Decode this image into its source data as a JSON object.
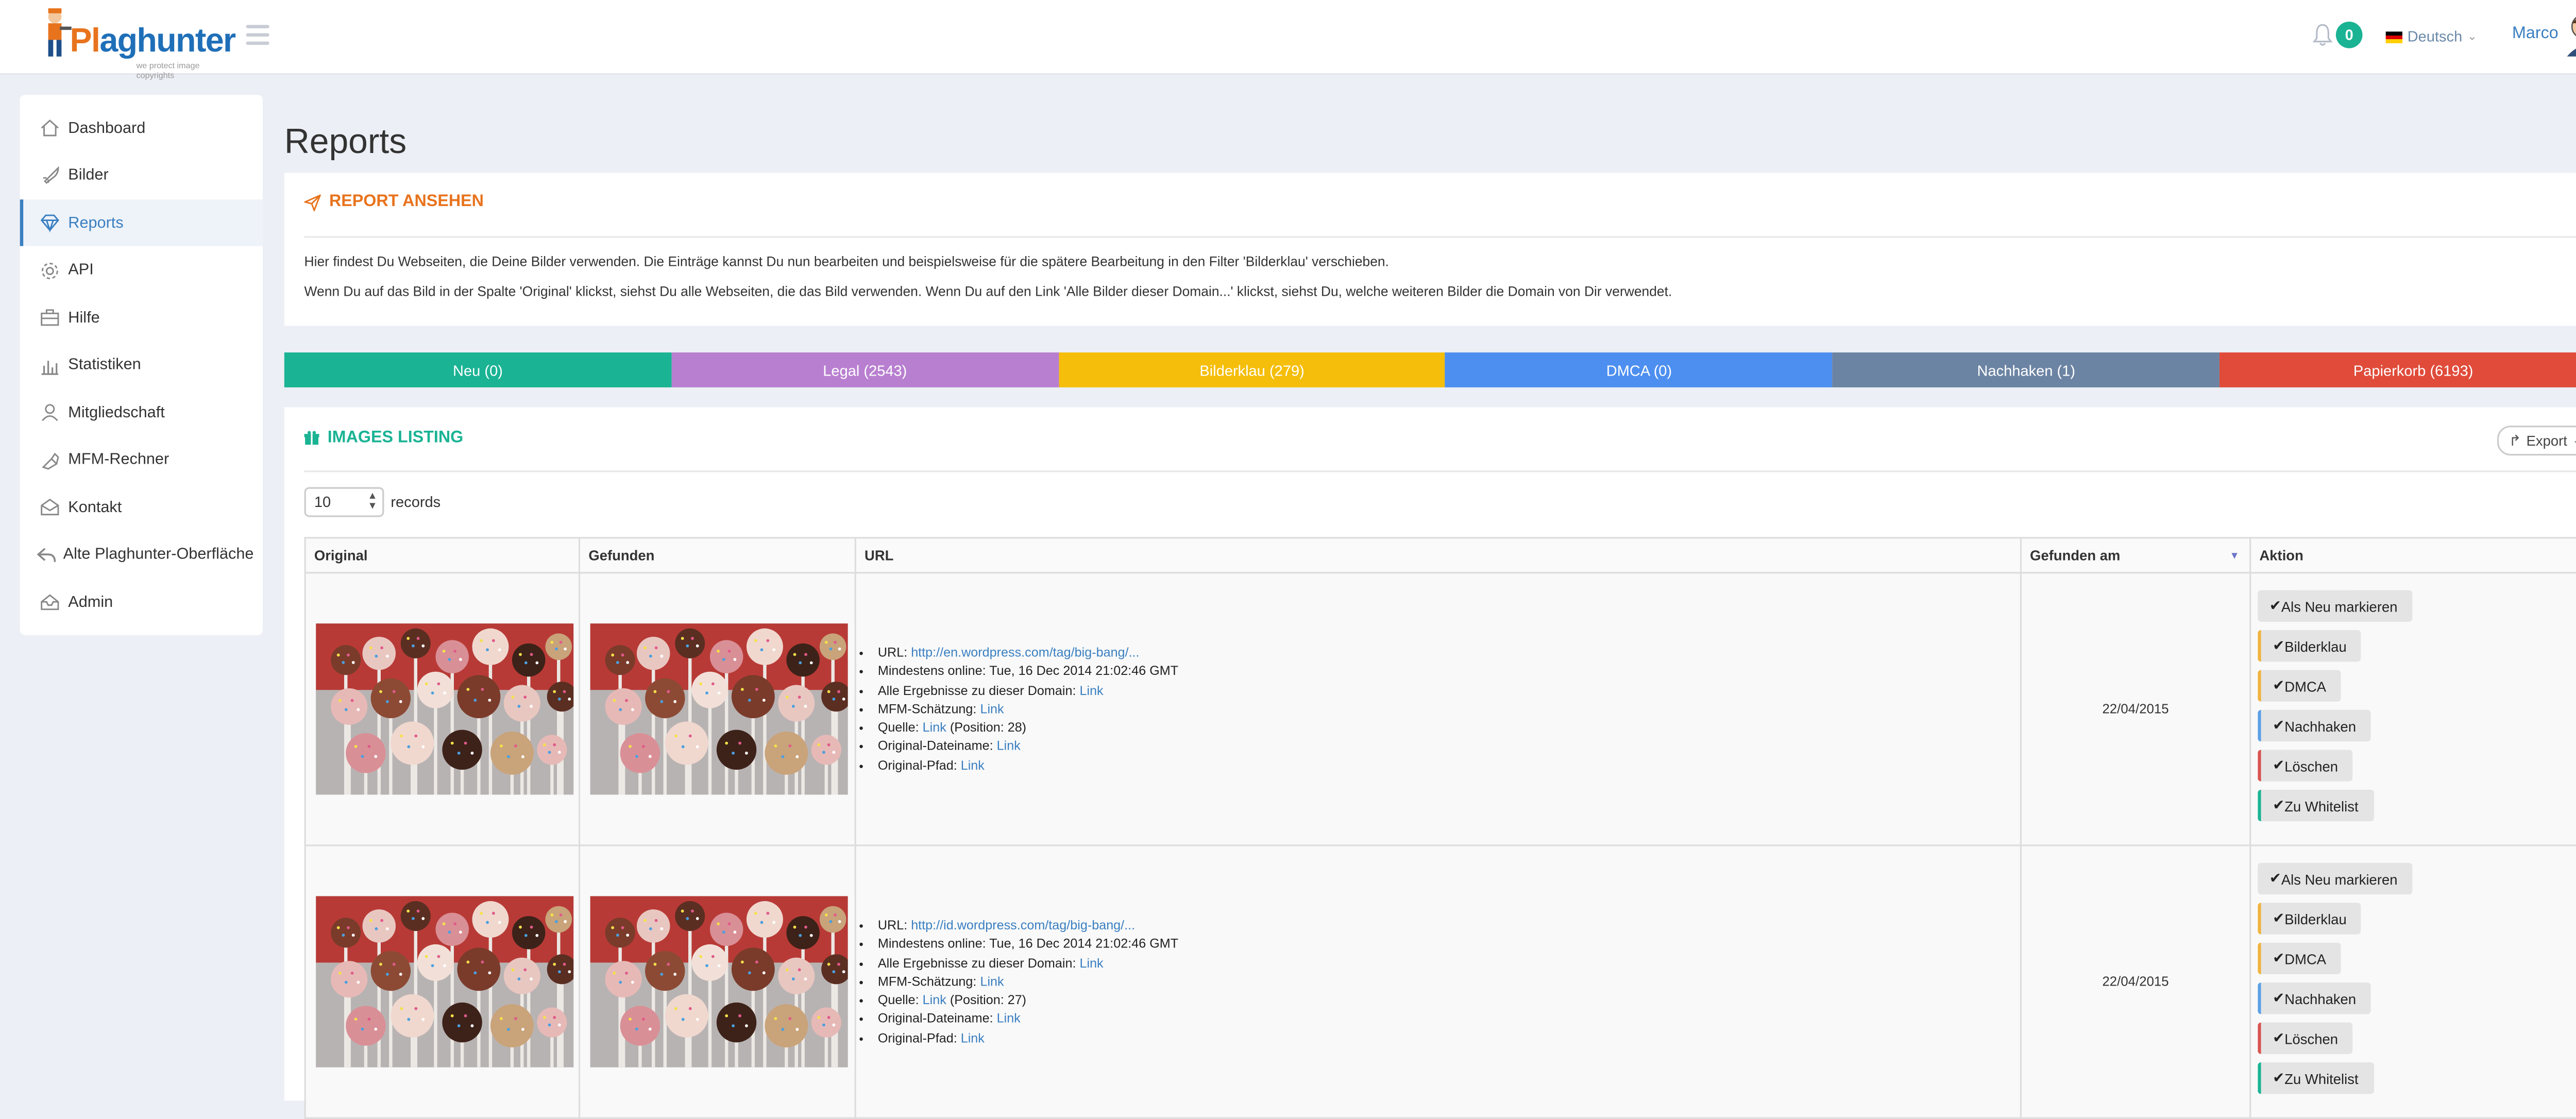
{
  "header": {
    "brand_part1": "Pl",
    "brand_part2": "aghunter",
    "tagline": "we protect image copyrights",
    "notification_count": "0",
    "language": "Deutsch",
    "user_name": "Marco"
  },
  "sidebar": {
    "items": [
      {
        "label": "Dashboard",
        "icon": "home-icon"
      },
      {
        "label": "Bilder",
        "icon": "rocket-icon"
      },
      {
        "label": "Reports",
        "icon": "diamond-icon",
        "active": true
      },
      {
        "label": "API",
        "icon": "gear-icon"
      },
      {
        "label": "Hilfe",
        "icon": "briefcase-icon"
      },
      {
        "label": "Statistiken",
        "icon": "bar-chart-icon"
      },
      {
        "label": "Mitgliedschaft",
        "icon": "user-icon"
      },
      {
        "label": "MFM-Rechner",
        "icon": "calculator-icon"
      },
      {
        "label": "Kontakt",
        "icon": "envelope-icon"
      },
      {
        "label": "Alte Plaghunter-Oberfläche",
        "icon": "reply-icon"
      },
      {
        "label": "Admin",
        "icon": "inbox-icon"
      }
    ]
  },
  "page": {
    "title": "Reports"
  },
  "report_panel": {
    "title": "REPORT ANSEHEN",
    "line1": "Hier findest Du Webseiten, die Deine Bilder verwenden. Die Einträge kannst Du nun bearbeiten und beispielsweise für die spätere Bearbeitung in den Filter 'Bilderklau' verschieben.",
    "line2": "Wenn Du auf das Bild in der Spalte 'Original' klickst, siehst Du alle Webseiten, die das Bild verwenden. Wenn Du auf den Link 'Alle Bilder dieser Domain...' klickst, siehst Du, welche weiteren Bilder die Domain von Dir verwendet."
  },
  "filter_tabs": [
    {
      "label": "Neu (0)",
      "color": "#1ab394"
    },
    {
      "label": "Legal (2543)",
      "color": "#b87fd0"
    },
    {
      "label": "Bilderklau (279)",
      "color": "#f5be0b"
    },
    {
      "label": "DMCA (0)",
      "color": "#4d8ff0"
    },
    {
      "label": "Nachhaken (1)",
      "color": "#6c84a3"
    },
    {
      "label": "Papierkorb (6193)",
      "color": "#e04b3a"
    }
  ],
  "listing": {
    "title": "IMAGES LISTING",
    "export_label": "Export",
    "records_value": "10",
    "records_label": "records",
    "columns": [
      "Original",
      "Gefunden",
      "URL",
      "Gefunden am",
      "Aktion"
    ],
    "labels": {
      "url": "URL:",
      "online": "Mindestens online:",
      "all_results": "Alle Ergebnisse zu dieser Domain:",
      "mfm": "MFM-Schätzung:",
      "source": "Quelle:",
      "filename": "Original-Dateiname:",
      "path": "Original-Pfad:",
      "link": "Link"
    },
    "actions": [
      "Als Neu markieren",
      "Bilderklau",
      "DMCA",
      "Nachhaken",
      "Löschen",
      "Zu Whitelist"
    ],
    "rows": [
      {
        "url": "http://en.wordpress.com/tag/big-bang/...",
        "online": "Tue, 16 Dec 2014 21:02:46 GMT",
        "position": "(Position: 28)",
        "date": "22/04/2015"
      },
      {
        "url": "http://id.wordpress.com/tag/big-bang/...",
        "online": "Tue, 16 Dec 2014 21:02:46 GMT",
        "position": "(Position: 27)",
        "date": "22/04/2015"
      }
    ]
  }
}
